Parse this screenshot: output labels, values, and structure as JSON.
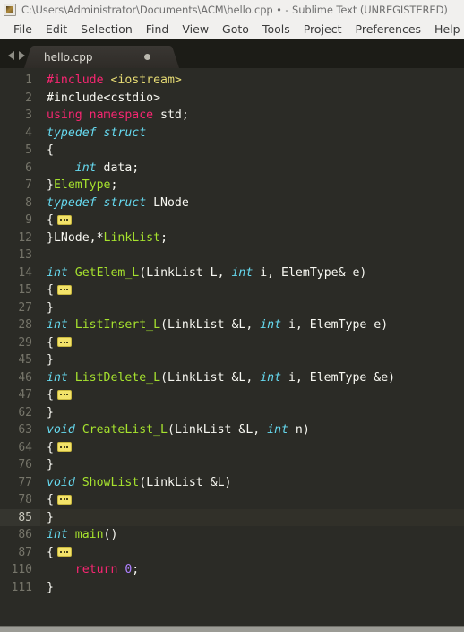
{
  "window": {
    "icon": "sublime-app-icon",
    "title": "C:\\Users\\Administrator\\Documents\\ACM\\hello.cpp • - Sublime Text (UNREGISTERED)"
  },
  "menubar": {
    "items": [
      {
        "label": "File"
      },
      {
        "label": "Edit"
      },
      {
        "label": "Selection"
      },
      {
        "label": "Find"
      },
      {
        "label": "View"
      },
      {
        "label": "Goto"
      },
      {
        "label": "Tools"
      },
      {
        "label": "Project"
      },
      {
        "label": "Preferences"
      },
      {
        "label": "Help"
      }
    ]
  },
  "tabbar": {
    "prev_icon": "arrow-left-icon",
    "next_icon": "arrow-right-icon",
    "tabs": [
      {
        "label": "hello.cpp",
        "dirty": true,
        "active": true
      }
    ]
  },
  "editor": {
    "language": "C++",
    "theme": "Monokai",
    "background": "#2b2b26",
    "gutter_color": "#76756a",
    "active_line": 85,
    "colors": {
      "keyword": "#f92672",
      "string": "#e6db74",
      "type": "#66d9ef",
      "function": "#a6e22e",
      "number": "#ae81ff",
      "text": "#f8f8f2",
      "fold_badge": "#f3e36a"
    },
    "lines": [
      {
        "num": "1",
        "tokens": [
          {
            "t": "#include ",
            "c": "t-pink"
          },
          {
            "t": "<iostream>",
            "c": "t-yellow"
          }
        ]
      },
      {
        "num": "2",
        "tokens": [
          {
            "t": "#include<cstdio>",
            "c": "t-plain"
          }
        ]
      },
      {
        "num": "3",
        "tokens": [
          {
            "t": "using namespace ",
            "c": "t-pink"
          },
          {
            "t": "std;",
            "c": "t-plain"
          }
        ]
      },
      {
        "num": "4",
        "tokens": [
          {
            "t": "typedef struct",
            "c": "t-cyan"
          }
        ]
      },
      {
        "num": "5",
        "tokens": [
          {
            "t": "{",
            "c": "t-plain"
          }
        ]
      },
      {
        "num": "6",
        "tokens": [
          {
            "t": "    ",
            "c": "t-plain"
          },
          {
            "t": "int",
            "c": "t-cyan"
          },
          {
            "t": " data;",
            "c": "t-plain"
          }
        ],
        "indent": true
      },
      {
        "num": "7",
        "tokens": [
          {
            "t": "}",
            "c": "t-plain"
          },
          {
            "t": "ElemType",
            "c": "t-green"
          },
          {
            "t": ";",
            "c": "t-plain"
          }
        ]
      },
      {
        "num": "8",
        "tokens": [
          {
            "t": "typedef struct",
            "c": "t-cyan"
          },
          {
            "t": " LNode",
            "c": "t-plain"
          }
        ]
      },
      {
        "num": "9",
        "tokens": [
          {
            "t": "{",
            "c": "t-plain"
          }
        ],
        "fold": true
      },
      {
        "num": "12",
        "tokens": [
          {
            "t": "}LNode,*",
            "c": "t-plain"
          },
          {
            "t": "LinkList",
            "c": "t-green"
          },
          {
            "t": ";",
            "c": "t-plain"
          }
        ]
      },
      {
        "num": "13",
        "tokens": []
      },
      {
        "num": "14",
        "tokens": [
          {
            "t": "int",
            "c": "t-cyan"
          },
          {
            "t": " ",
            "c": "t-plain"
          },
          {
            "t": "GetElem_L",
            "c": "t-green"
          },
          {
            "t": "(LinkList L, ",
            "c": "t-plain"
          },
          {
            "t": "int",
            "c": "t-cyan"
          },
          {
            "t": " i, ElemType& e)",
            "c": "t-plain"
          }
        ]
      },
      {
        "num": "15",
        "tokens": [
          {
            "t": "{",
            "c": "t-plain"
          }
        ],
        "fold": true
      },
      {
        "num": "27",
        "tokens": [
          {
            "t": "}",
            "c": "t-plain"
          }
        ]
      },
      {
        "num": "28",
        "tokens": [
          {
            "t": "int",
            "c": "t-cyan"
          },
          {
            "t": " ",
            "c": "t-plain"
          },
          {
            "t": "ListInsert_L",
            "c": "t-green"
          },
          {
            "t": "(LinkList &L, ",
            "c": "t-plain"
          },
          {
            "t": "int",
            "c": "t-cyan"
          },
          {
            "t": " i, ElemType e)",
            "c": "t-plain"
          }
        ]
      },
      {
        "num": "29",
        "tokens": [
          {
            "t": "{",
            "c": "t-plain"
          }
        ],
        "fold": true
      },
      {
        "num": "45",
        "tokens": [
          {
            "t": "}",
            "c": "t-plain"
          }
        ]
      },
      {
        "num": "46",
        "tokens": [
          {
            "t": "int",
            "c": "t-cyan"
          },
          {
            "t": " ",
            "c": "t-plain"
          },
          {
            "t": "ListDelete_L",
            "c": "t-green"
          },
          {
            "t": "(LinkList &L, ",
            "c": "t-plain"
          },
          {
            "t": "int",
            "c": "t-cyan"
          },
          {
            "t": " i, ElemType &e)",
            "c": "t-plain"
          }
        ]
      },
      {
        "num": "47",
        "tokens": [
          {
            "t": "{",
            "c": "t-plain"
          }
        ],
        "fold": true
      },
      {
        "num": "62",
        "tokens": [
          {
            "t": "}",
            "c": "t-plain"
          }
        ]
      },
      {
        "num": "63",
        "tokens": [
          {
            "t": "void",
            "c": "t-cyan"
          },
          {
            "t": " ",
            "c": "t-plain"
          },
          {
            "t": "CreateList_L",
            "c": "t-green"
          },
          {
            "t": "(LinkList &L, ",
            "c": "t-plain"
          },
          {
            "t": "int",
            "c": "t-cyan"
          },
          {
            "t": " n)",
            "c": "t-plain"
          }
        ]
      },
      {
        "num": "64",
        "tokens": [
          {
            "t": "{",
            "c": "t-plain"
          }
        ],
        "fold": true
      },
      {
        "num": "76",
        "tokens": [
          {
            "t": "}",
            "c": "t-plain"
          }
        ]
      },
      {
        "num": "77",
        "tokens": [
          {
            "t": "void",
            "c": "t-cyan"
          },
          {
            "t": " ",
            "c": "t-plain"
          },
          {
            "t": "ShowList",
            "c": "t-green"
          },
          {
            "t": "(LinkList &L)",
            "c": "t-plain"
          }
        ]
      },
      {
        "num": "78",
        "tokens": [
          {
            "t": "{",
            "c": "t-plain"
          }
        ],
        "fold": true
      },
      {
        "num": "85",
        "tokens": [
          {
            "t": "}",
            "c": "t-plain"
          }
        ],
        "active": true
      },
      {
        "num": "86",
        "tokens": [
          {
            "t": "int",
            "c": "t-cyan"
          },
          {
            "t": " ",
            "c": "t-plain"
          },
          {
            "t": "main",
            "c": "t-green"
          },
          {
            "t": "()",
            "c": "t-plain"
          }
        ]
      },
      {
        "num": "87",
        "tokens": [
          {
            "t": "{",
            "c": "t-plain"
          }
        ],
        "fold": true
      },
      {
        "num": "110",
        "tokens": [
          {
            "t": "    ",
            "c": "t-plain"
          },
          {
            "t": "return ",
            "c": "t-pink"
          },
          {
            "t": "0",
            "c": "t-purple"
          },
          {
            "t": ";",
            "c": "t-plain"
          }
        ],
        "indent": true
      },
      {
        "num": "111",
        "tokens": [
          {
            "t": "}",
            "c": "t-plain"
          }
        ]
      }
    ]
  }
}
